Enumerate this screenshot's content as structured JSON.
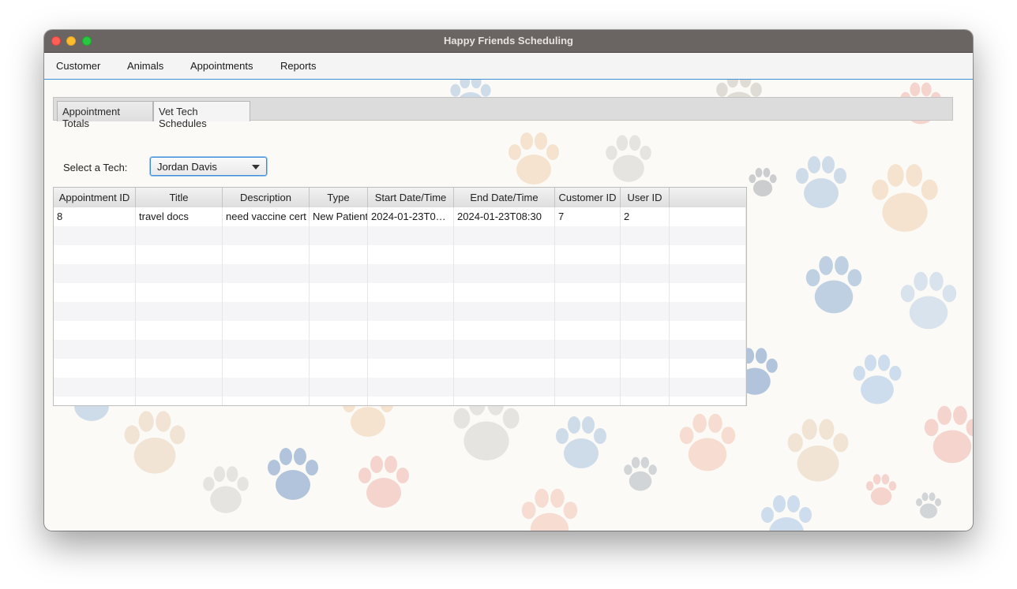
{
  "window": {
    "title": "Happy Friends Scheduling"
  },
  "menubar": {
    "items": [
      {
        "label": "Customer"
      },
      {
        "label": "Animals"
      },
      {
        "label": "Appointments"
      },
      {
        "label": "Reports"
      }
    ]
  },
  "tabs": [
    {
      "label": "Appointment Totals",
      "active": false
    },
    {
      "label": "Vet Tech Schedules",
      "active": true
    }
  ],
  "tech_select": {
    "label": "Select a Tech:",
    "value": "Jordan Davis"
  },
  "table": {
    "columns": [
      "Appointment ID",
      "Title",
      "Description",
      "Type",
      "Start Date/Time",
      "End Date/Time",
      "Customer ID",
      "User ID"
    ],
    "rows": [
      [
        "8",
        "travel docs",
        "need vaccine cert",
        "New Patient",
        "2024-01-23T0…",
        "2024-01-23T08:30",
        "7",
        "2"
      ]
    ]
  },
  "colors": {
    "titlebar": "#6a6462",
    "accent": "#3d8fd6",
    "paw_blue": "#8fb0d6",
    "paw_orange": "#ecc49a",
    "paw_gray": "#c9c6c2",
    "paw_red": "#ec9f96"
  }
}
